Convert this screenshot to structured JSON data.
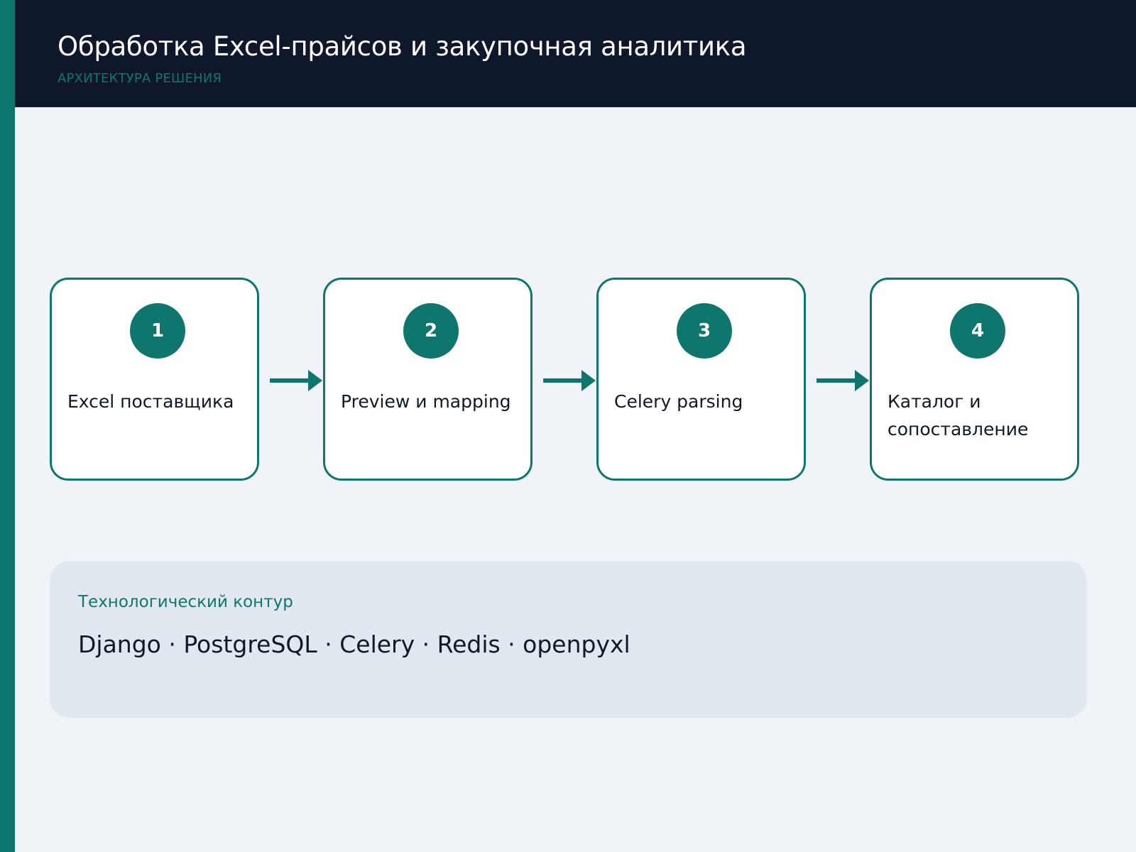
{
  "header": {
    "title": "Обработка Excel-прайсов и закупочная аналитика",
    "subtitle": "АРХИТЕКТУРА РЕШЕНИЯ"
  },
  "steps": [
    {
      "number": "1",
      "label": "Excel поставщика"
    },
    {
      "number": "2",
      "label": "Preview и mapping"
    },
    {
      "number": "3",
      "label": "Celery parsing"
    },
    {
      "number": "4",
      "label": "Каталог и сопоставление"
    }
  ],
  "tech": {
    "label": "Технологический контур",
    "stack": "Django · PostgreSQL · Celery · Redis · openpyxl"
  },
  "colors": {
    "accent": "#0f766e",
    "header_bg": "#0f172a",
    "page_bg": "#f0f4f8",
    "panel_bg": "#e2e8f0",
    "card_bg": "#ffffff",
    "text_dark": "#111827"
  },
  "icons": [
    "arrow-right-icon"
  ]
}
